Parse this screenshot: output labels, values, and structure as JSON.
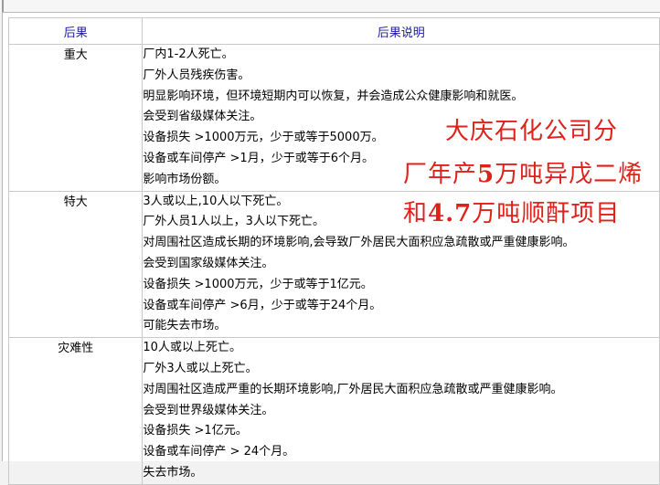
{
  "table": {
    "headers": {
      "level": "后果",
      "description": "后果说明"
    },
    "rows": [
      {
        "level": "重大",
        "lines": [
          "厂内1-2人死亡。",
          "厂外人员残疾伤害。",
          "明显影响环境，但环境短期内可以恢复，并会造成公众健康影响和就医。",
          "会受到省级媒体关注。",
          "设备损失 >1000万元，少于或等于5000万。",
          "设备或车间停产 >1月，少于或等于6个月。",
          "影响市场份额。"
        ]
      },
      {
        "level": "特大",
        "lines": [
          "3人或以上,10人以下死亡。",
          "厂外人员1人以上，3人以下死亡。",
          "对周围社区造成长期的环境影响,会导致厂外居民大面积应急疏散或严重健康影响。",
          "会受到国家级媒体关注。",
          "设备损失 >1000万元，少于或等于1亿元。",
          "设备或车间停产 >6月，少于或等于24个月。",
          "可能失去市场。"
        ]
      },
      {
        "level": "灾难性",
        "lines": [
          "10人或以上死亡。",
          "厂外3人或以上死亡。",
          "对周围社区造成严重的长期环境影响,厂外居民大面积应急疏散或严重健康影响。",
          "会受到世界级媒体关注。",
          "设备损失 >1亿元。",
          "设备或车间停产 > 24个月。",
          "失去市场。"
        ]
      }
    ]
  },
  "overlay": {
    "line1": "大庆石化公司分",
    "line2_pre": "厂年产",
    "line2_num": "5",
    "line2_post": "万吨异戊二烯",
    "line3_pre": "和",
    "line3_num": "4.7",
    "line3_post": "万吨顺酐项目"
  },
  "colors": {
    "header_text": "#1a1aa0",
    "overlay_text": "#e0201a",
    "border": "#c9c9c9"
  }
}
